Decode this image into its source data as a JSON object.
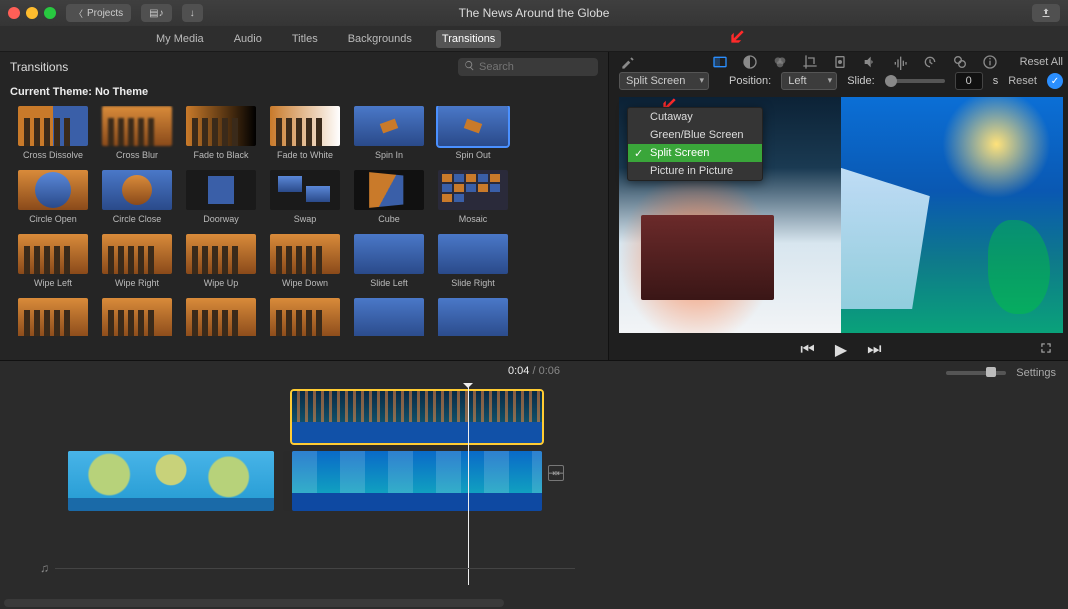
{
  "titlebar": {
    "back_label": "Projects",
    "title": "The News Around the Globe"
  },
  "tabs": {
    "items": [
      "My Media",
      "Audio",
      "Titles",
      "Backgrounds",
      "Transitions"
    ],
    "active_index": 4
  },
  "browser": {
    "title": "Transitions",
    "search_placeholder": "Search",
    "theme_label": "Current Theme: No Theme",
    "items": [
      "Cross Dissolve",
      "Cross Blur",
      "Fade to Black",
      "Fade to White",
      "Spin In",
      "Spin Out",
      "Circle Open",
      "Circle Close",
      "Doorway",
      "Swap",
      "Cube",
      "Mosaic",
      "Wipe Left",
      "Wipe Right",
      "Wipe Up",
      "Wipe Down",
      "Slide Left",
      "Slide Right"
    ],
    "selected_index": 5
  },
  "viewer": {
    "reset_all": "Reset All",
    "overlay_control": {
      "selected": "Split Screen",
      "options": [
        "Cutaway",
        "Green/Blue Screen",
        "Split Screen",
        "Picture in Picture"
      ]
    },
    "position_label": "Position:",
    "position_value": "Left",
    "slide_label": "Slide:",
    "slide_value": "0",
    "slide_unit": "s",
    "reset": "Reset"
  },
  "timeline": {
    "current_time": "0:04",
    "divider": " / ",
    "total_time": "0:06",
    "settings": "Settings"
  }
}
